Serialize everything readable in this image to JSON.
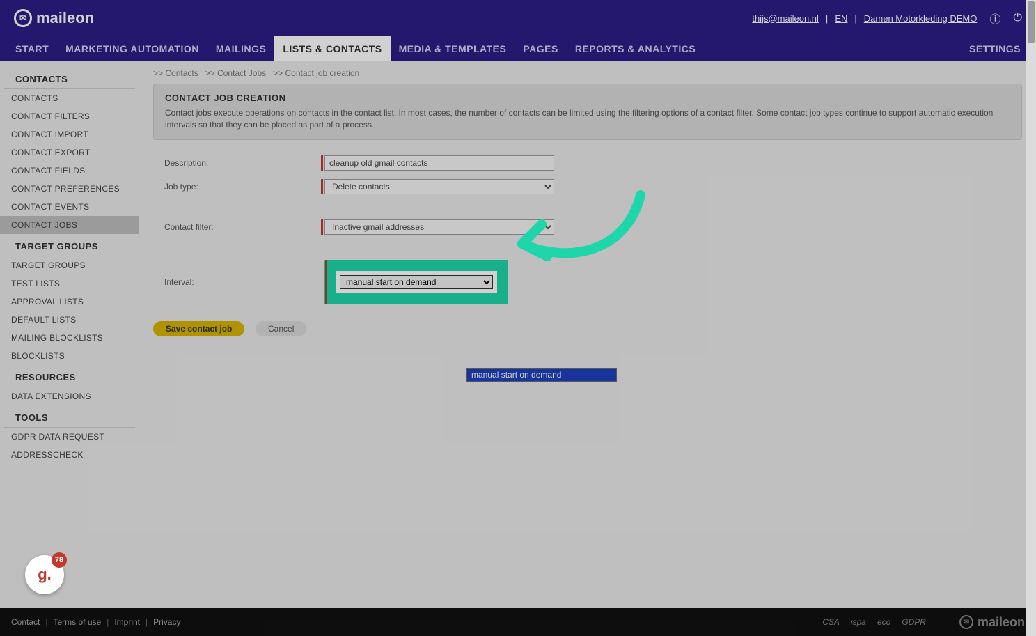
{
  "brand": "maileon",
  "top": {
    "email": "thijs@maileon.nl",
    "lang": "EN",
    "account": "Damen Motorkleding DEMO"
  },
  "nav": {
    "items": [
      "START",
      "MARKETING AUTOMATION",
      "MAILINGS",
      "LISTS & CONTACTS",
      "MEDIA & TEMPLATES",
      "PAGES",
      "REPORTS & ANALYTICS"
    ],
    "settings": "SETTINGS",
    "active": 3
  },
  "sidebar": {
    "sections": [
      {
        "title": "CONTACTS",
        "items": [
          "CONTACTS",
          "CONTACT FILTERS",
          "CONTACT IMPORT",
          "CONTACT EXPORT",
          "CONTACT FIELDS",
          "CONTACT PREFERENCES",
          "CONTACT EVENTS",
          "CONTACT JOBS"
        ],
        "active": 7
      },
      {
        "title": "TARGET GROUPS",
        "items": [
          "TARGET GROUPS",
          "TEST LISTS",
          "APPROVAL LISTS",
          "DEFAULT LISTS",
          "MAILING BLOCKLISTS",
          "BLOCKLISTS"
        ]
      },
      {
        "title": "RESOURCES",
        "items": [
          "DATA EXTENSIONS"
        ]
      },
      {
        "title": "TOOLS",
        "items": [
          "GDPR DATA REQUEST",
          "ADDRESSCHECK"
        ]
      }
    ]
  },
  "crumbs": [
    {
      "label": "Contacts",
      "link": false
    },
    {
      "label": "Contact Jobs",
      "link": true
    },
    {
      "label": "Contact job creation",
      "link": false
    }
  ],
  "header": {
    "title": "CONTACT JOB CREATION",
    "desc": "Contact jobs execute operations on contacts in the contact list. In most cases, the number of contacts can be limited using the filtering options of a contact filter. Some contact job types continue to support automatic execution intervals so that they can be placed as part of a process."
  },
  "form": {
    "description": {
      "label": "Description:",
      "value": "cleanup old gmail contacts"
    },
    "jobtype": {
      "label": "Job type:",
      "value": "Delete contacts"
    },
    "contactfilter": {
      "label": "Contact filter:",
      "value": "Inactive gmail addresses"
    },
    "interval": {
      "label": "Interval:",
      "value": "manual start on demand"
    }
  },
  "dropdown": {
    "option": "manual start on demand"
  },
  "buttons": {
    "save": "Save contact job",
    "cancel": "Cancel"
  },
  "footer": {
    "links": [
      "Contact",
      "Terms of use",
      "Imprint",
      "Privacy"
    ],
    "certs": [
      "CSA",
      "ispa",
      "eco",
      "GDPR"
    ]
  },
  "bubble": {
    "glyph": "g.",
    "count": "78"
  }
}
